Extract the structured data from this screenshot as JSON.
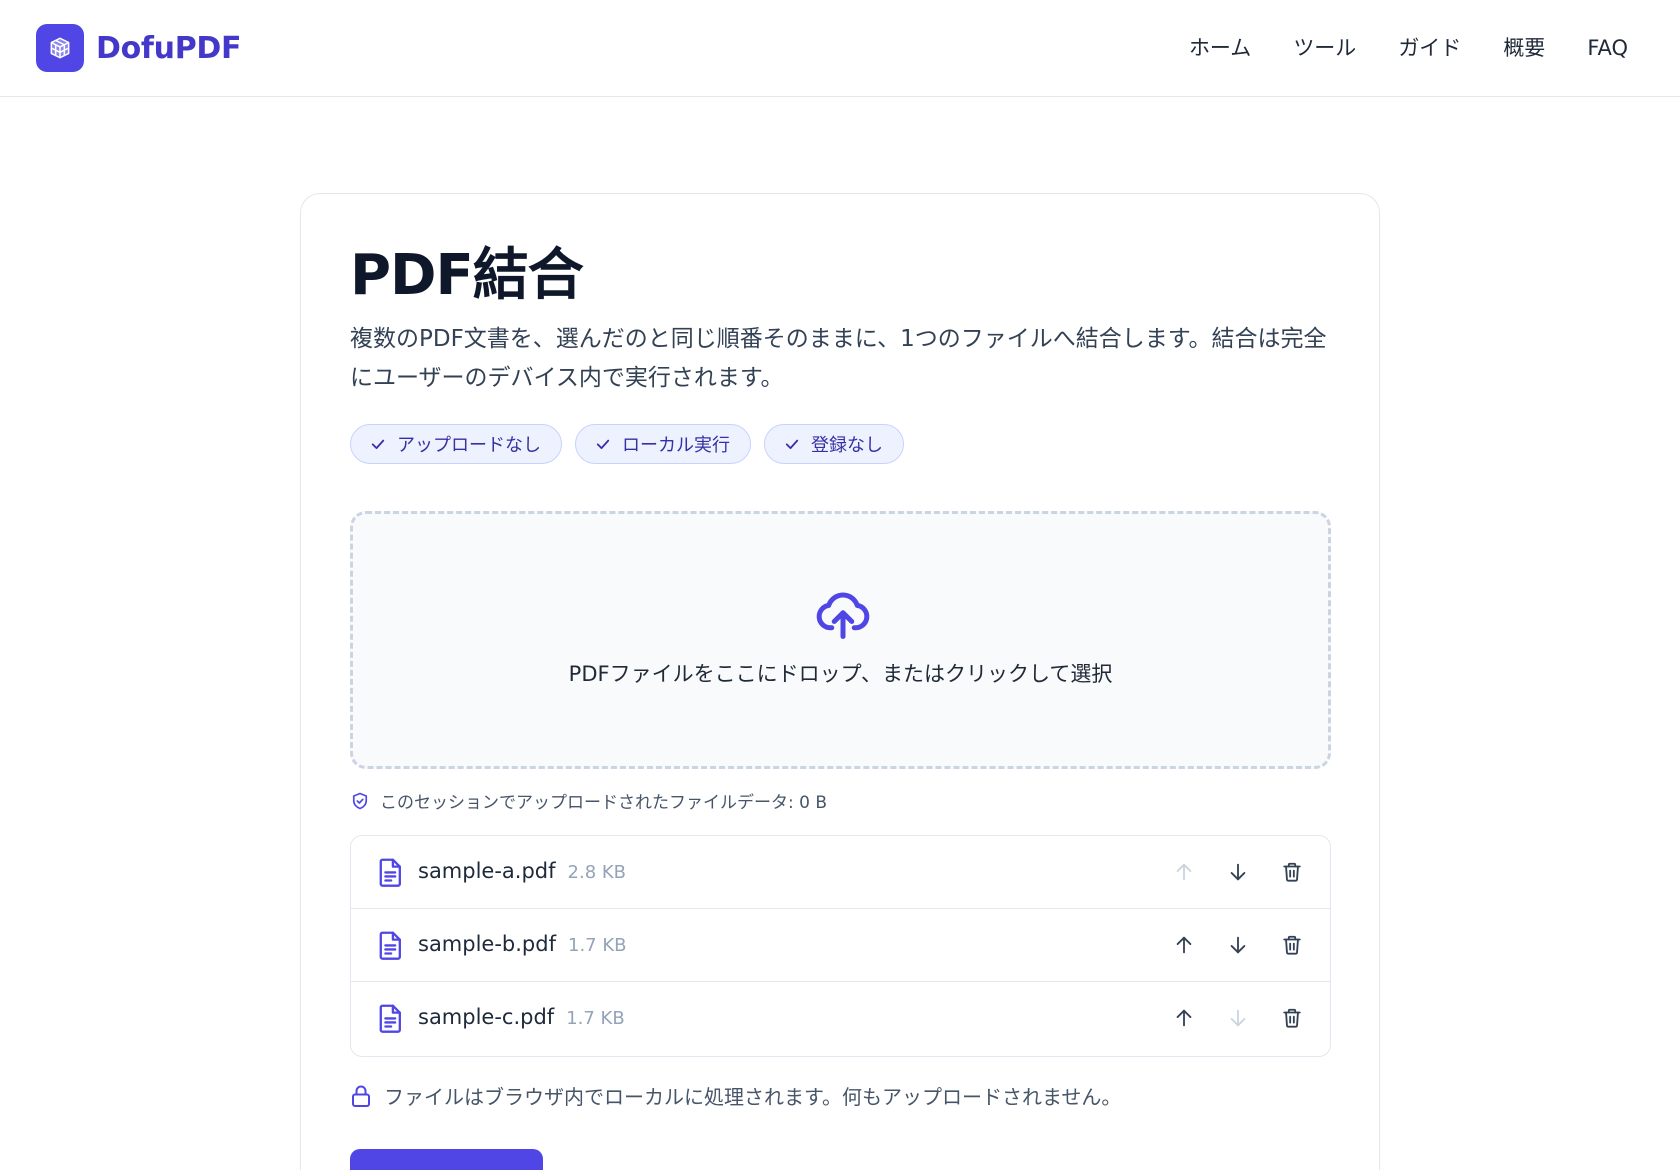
{
  "header": {
    "brand": "DofuPDF",
    "nav": [
      "ホーム",
      "ツール",
      "ガイド",
      "概要",
      "FAQ"
    ]
  },
  "tool": {
    "title": "PDF結合",
    "description": "複数のPDF文書を、選んだのと同じ順番そのままに、1つのファイルへ結合します。結合は完全にユーザーのデバイス内で実行されます。",
    "badges": [
      "アップロードなし",
      "ローカル実行",
      "登録なし"
    ],
    "dropzone_text": "PDFファイルをここにドロップ、またはクリックして選択",
    "session_note": "このセッションでアップロードされたファイルデータ: 0 B",
    "files": [
      {
        "name": "sample-a.pdf",
        "size": "2.8 KB",
        "can_move_up": false,
        "can_move_down": true
      },
      {
        "name": "sample-b.pdf",
        "size": "1.7 KB",
        "can_move_up": true,
        "can_move_down": true
      },
      {
        "name": "sample-c.pdf",
        "size": "1.7 KB",
        "can_move_up": true,
        "can_move_down": false
      }
    ],
    "local_note": "ファイルはブラウザ内でローカルに処理されます。何もアップロードされません。",
    "merge_button": ""
  },
  "colors": {
    "accent": "#4f46e5",
    "brand_text": "#4338ca",
    "badge_bg": "#eef2ff",
    "badge_border": "#c7d2fe",
    "action_active": "#334155",
    "action_disabled": "#cbd5e1"
  },
  "icons": {
    "logo": "cube-icon",
    "badge": "check-icon",
    "dropzone": "cloud-upload-icon",
    "session": "shield-check-icon",
    "file": "file-text-icon",
    "move_up": "arrow-up-icon",
    "move_down": "arrow-down-icon",
    "remove": "trash-icon",
    "local": "lock-icon"
  }
}
